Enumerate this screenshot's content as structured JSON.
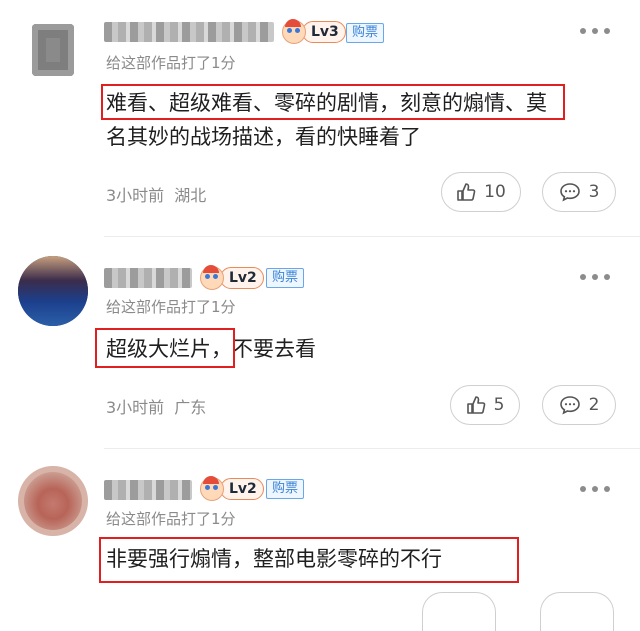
{
  "comments": [
    {
      "level": "Lv3",
      "ticket": "购票",
      "rating": "给这部作品打了1分",
      "text_highlight": "难看、超级难看、零碎的剧情，刻意的煽情、",
      "text_rest_line1": "莫",
      "text_line2": "名其妙的战场描述，看的快睡着了",
      "time": "3小时前",
      "location": "湖北",
      "likes": "10",
      "replies": "3"
    },
    {
      "level": "Lv2",
      "ticket": "购票",
      "rating": "给这部作品打了1分",
      "text_highlight": "超级大烂片，",
      "text_rest_line1": "不要去看",
      "time": "3小时前",
      "location": "广东",
      "likes": "5",
      "replies": "2"
    },
    {
      "level": "Lv2",
      "ticket": "购票",
      "rating": "给这部作品打了1分",
      "text_highlight": "非要强行煽情，整部电影零碎的不行"
    }
  ],
  "colors": {
    "highlight_box": "#e02020",
    "ticket": "#3e85d6",
    "level_border": "#e98a5b"
  },
  "icons": {
    "like": "thumbs-up-icon",
    "reply": "chat-bubble-icon",
    "more": "more-dots-icon"
  }
}
